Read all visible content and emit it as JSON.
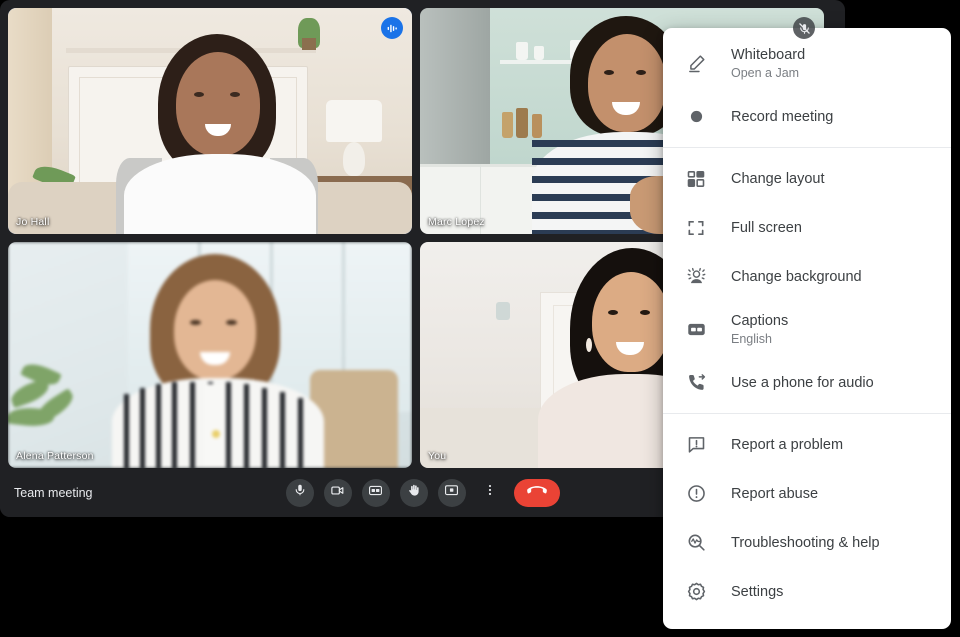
{
  "app": {
    "name": "google-meet"
  },
  "meeting": {
    "title": "Team meeting",
    "participants": [
      {
        "name": "Jo Hall",
        "status": "speaking",
        "active": true,
        "self": false
      },
      {
        "name": "Marc Lopez",
        "status": "muted",
        "active": false,
        "self": false
      },
      {
        "name": "Alena Patterson",
        "status": "none",
        "active": false,
        "self": false
      },
      {
        "name": "You",
        "status": "none",
        "active": false,
        "self": true
      }
    ]
  },
  "controls": [
    {
      "id": "microphone",
      "icon": "microphone-icon",
      "label": "Turn off microphone"
    },
    {
      "id": "camera",
      "icon": "camera-icon",
      "label": "Turn off camera"
    },
    {
      "id": "captions",
      "icon": "closed-captions-icon",
      "label": "Turn on captions"
    },
    {
      "id": "raise-hand",
      "icon": "raise-hand-icon",
      "label": "Raise hand"
    },
    {
      "id": "present-screen",
      "icon": "present-screen-icon",
      "label": "Present now"
    },
    {
      "id": "more-options",
      "icon": "more-vertical-icon",
      "label": "More options"
    },
    {
      "id": "end-call",
      "icon": "end-call-icon",
      "label": "Leave call"
    }
  ],
  "menu": {
    "sections": [
      {
        "items": [
          {
            "id": "whiteboard",
            "icon": "pen-icon",
            "label": "Whiteboard",
            "sublabel": "Open a Jam"
          },
          {
            "id": "record-meeting",
            "icon": "record-circle-icon",
            "label": "Record meeting",
            "sublabel": ""
          }
        ]
      },
      {
        "items": [
          {
            "id": "change-layout",
            "icon": "layout-grid-icon",
            "label": "Change layout",
            "sublabel": ""
          },
          {
            "id": "full-screen",
            "icon": "fullscreen-icon",
            "label": "Full screen",
            "sublabel": ""
          },
          {
            "id": "change-background",
            "icon": "change-background-icon",
            "label": "Change background",
            "sublabel": ""
          },
          {
            "id": "captions",
            "icon": "closed-captions-icon",
            "label": "Captions",
            "sublabel": "English"
          },
          {
            "id": "phone-audio",
            "icon": "phone-forward-icon",
            "label": "Use a phone for audio",
            "sublabel": ""
          }
        ]
      },
      {
        "items": [
          {
            "id": "report-problem",
            "icon": "feedback-icon",
            "label": "Report a problem",
            "sublabel": ""
          },
          {
            "id": "report-abuse",
            "icon": "alert-circle-icon",
            "label": "Report abuse",
            "sublabel": ""
          },
          {
            "id": "troubleshooting",
            "icon": "troubleshooting-icon",
            "label": "Troubleshooting & help",
            "sublabel": ""
          },
          {
            "id": "settings",
            "icon": "gear-icon",
            "label": "Settings",
            "sublabel": ""
          }
        ]
      }
    ]
  },
  "colors": {
    "window_bg": "#202124",
    "control_bg": "#3c4043",
    "end_call": "#ea4335",
    "active_speaker_border": "#4285f4",
    "speaking_badge": "#1a73e8",
    "menu_bg": "#ffffff",
    "menu_text": "#3c4043",
    "menu_sub_text": "#7a7e83",
    "menu_icon": "#5f6368"
  }
}
